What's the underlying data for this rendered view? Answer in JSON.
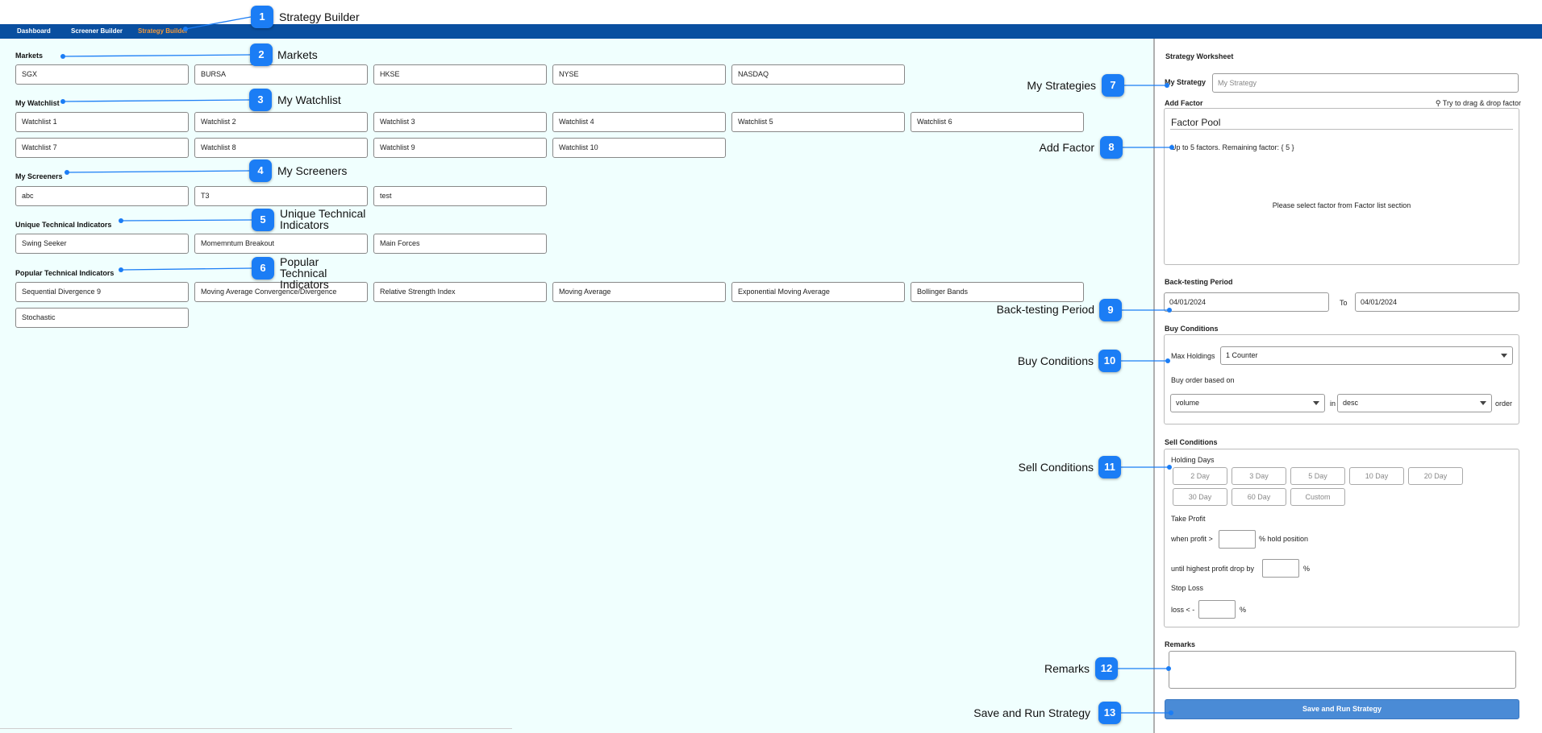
{
  "nav": {
    "items": [
      "Dashboard",
      "Screener Builder",
      "Strategy Builder"
    ],
    "active": "Strategy Builder"
  },
  "sections": {
    "markets": {
      "title": "Markets",
      "items": [
        "SGX",
        "BURSA",
        "HKSE",
        "NYSE",
        "NASDAQ"
      ]
    },
    "watchlist": {
      "title": "My Watchlist",
      "items": [
        "Watchlist 1",
        "Watchlist 2",
        "Watchlist 3",
        "Watchlist 4",
        "Watchlist 5",
        "Watchlist 6",
        "Watchlist 7",
        "Watchlist 8",
        "Watchlist 9",
        "Watchlist 10"
      ]
    },
    "screeners": {
      "title": "My Screeners",
      "items": [
        "abc",
        "T3",
        "test"
      ]
    },
    "unique": {
      "title": "Unique Technical Indicators",
      "items": [
        "Swing Seeker",
        "Momemntum Breakout",
        "Main Forces"
      ]
    },
    "popular": {
      "title": "Popular Technical Indicators",
      "items": [
        "Sequential Divergence 9",
        "Moving Average Convergence/Divergence",
        "Relative Strength Index",
        "Moving Average",
        "Exponential Moving Average",
        "Bollinger Bands",
        "Stochastic"
      ]
    }
  },
  "worksheet": {
    "title": "Strategy Worksheet",
    "my_strategy_label": "My Strategy",
    "my_strategy_placeholder": "My Strategy",
    "add_factor_label": "Add Factor",
    "drag_hint": "Try to drag & drop factor",
    "factor_pool_title": "Factor Pool",
    "factor_limit_text": "Up to 5 factors. Remaining factor: { 5 }",
    "factor_empty_text": "Please select factor from Factor list section",
    "backtest_label": "Back-testing Period",
    "backtest_from": "04/01/2024",
    "backtest_to_label": "To",
    "backtest_to": "04/01/2024",
    "buy_label": "Buy Conditions",
    "max_holdings_label": "Max Holdings",
    "max_holdings_value": "1 Counter",
    "buy_order_label": "Buy order based on",
    "buy_order_field": "volume",
    "in_label": "in",
    "buy_order_dir": "desc",
    "order_label": "order",
    "sell_label": "Sell Conditions",
    "holding_days_label": "Holding Days",
    "holding_days": [
      "2 Day",
      "3 Day",
      "5 Day",
      "10 Day",
      "20 Day",
      "30 Day",
      "60 Day",
      "Custom"
    ],
    "take_profit_label": "Take Profit",
    "when_profit_label": "when profit >",
    "hold_position_label": "% hold position",
    "until_drop_label": "until highest profit drop by",
    "percent": "%",
    "stop_loss_label": "Stop Loss",
    "loss_label": "loss < -",
    "remarks_label": "Remarks",
    "save_button": "Save and Run Strategy"
  },
  "annotations": [
    {
      "n": "1",
      "label": "Strategy Builder"
    },
    {
      "n": "2",
      "label": "Markets"
    },
    {
      "n": "3",
      "label": "My Watchlist"
    },
    {
      "n": "4",
      "label": "My Screeners"
    },
    {
      "n": "5",
      "label": "Unique Technical Indicators"
    },
    {
      "n": "6",
      "label": "Popular Technical Indicators"
    },
    {
      "n": "7",
      "label": "My Strategies"
    },
    {
      "n": "8",
      "label": "Add Factor"
    },
    {
      "n": "9",
      "label": "Back-testing Period"
    },
    {
      "n": "10",
      "label": "Buy Conditions"
    },
    {
      "n": "11",
      "label": "Sell Conditions"
    },
    {
      "n": "12",
      "label": "Remarks"
    },
    {
      "n": "13",
      "label": "Save and Run Strategy"
    }
  ],
  "colors": {
    "nav": "#0a4fa0",
    "active_nav": "#f59a3a",
    "panel_bg": "#f0fffe",
    "badge": "#1b7df5",
    "save_button": "#4a8bd6"
  }
}
